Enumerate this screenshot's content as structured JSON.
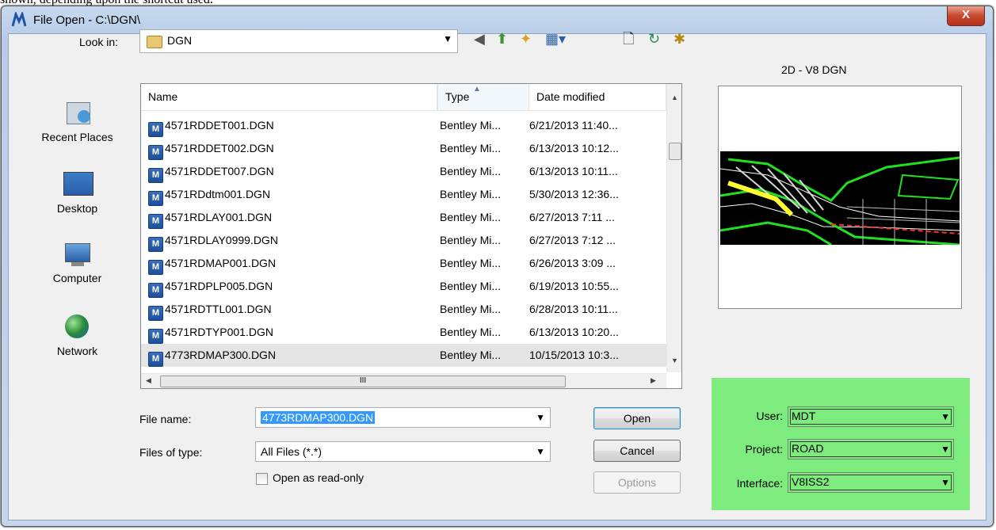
{
  "caption": "shown, depending upon the shortcut used.",
  "window": {
    "title": "File Open - C:\\DGN\\",
    "close_label": "X"
  },
  "lookin": {
    "label": "Look in:",
    "value": "DGN"
  },
  "places": [
    {
      "label": "Recent Places"
    },
    {
      "label": "Desktop"
    },
    {
      "label": "Computer"
    },
    {
      "label": "Network"
    }
  ],
  "columns": {
    "name": "Name",
    "type": "Type",
    "date": "Date modified"
  },
  "files": [
    {
      "name": "4571RDDET001.DGN",
      "type": "Bentley Mi...",
      "date": "6/21/2013 11:40..."
    },
    {
      "name": "4571RDDET002.DGN",
      "type": "Bentley Mi...",
      "date": "6/13/2013 10:12..."
    },
    {
      "name": "4571RDDET007.DGN",
      "type": "Bentley Mi...",
      "date": "6/13/2013 10:11..."
    },
    {
      "name": "4571RDdtm001.DGN",
      "type": "Bentley Mi...",
      "date": "5/30/2013 12:36..."
    },
    {
      "name": "4571RDLAY001.DGN",
      "type": "Bentley Mi...",
      "date": "6/27/2013 7:11 ..."
    },
    {
      "name": "4571RDLAY0999.DGN",
      "type": "Bentley Mi...",
      "date": "6/27/2013 7:12 ..."
    },
    {
      "name": "4571RDMAP001.DGN",
      "type": "Bentley Mi...",
      "date": "6/26/2013 3:09 ..."
    },
    {
      "name": "4571RDPLP005.DGN",
      "type": "Bentley Mi...",
      "date": "6/19/2013 10:55..."
    },
    {
      "name": "4571RDTTL001.DGN",
      "type": "Bentley Mi...",
      "date": "6/28/2013 10:11..."
    },
    {
      "name": "4571RDTYP001.DGN",
      "type": "Bentley Mi...",
      "date": "6/13/2013 10:20..."
    },
    {
      "name": "4773RDMAP300.DGN",
      "type": "Bentley Mi...",
      "date": "10/15/2013 10:3..."
    }
  ],
  "hscroll_grip": "III",
  "filename": {
    "label": "File name:",
    "value": "4773RDMAP300.DGN"
  },
  "filetype": {
    "label": "Files of type:",
    "value": "All Files (*.*)"
  },
  "readonly": {
    "label": "Open as read-only"
  },
  "buttons": {
    "open": "Open",
    "cancel": "Cancel",
    "options": "Options"
  },
  "preview": {
    "title": "2D - V8 DGN"
  },
  "workspace": {
    "user_label": "User:",
    "user_value": "MDT",
    "project_label": "Project:",
    "project_value": "ROAD",
    "interface_label": "Interface:",
    "interface_value": "V8ISS2",
    "bg_color": "#7deb7d"
  }
}
